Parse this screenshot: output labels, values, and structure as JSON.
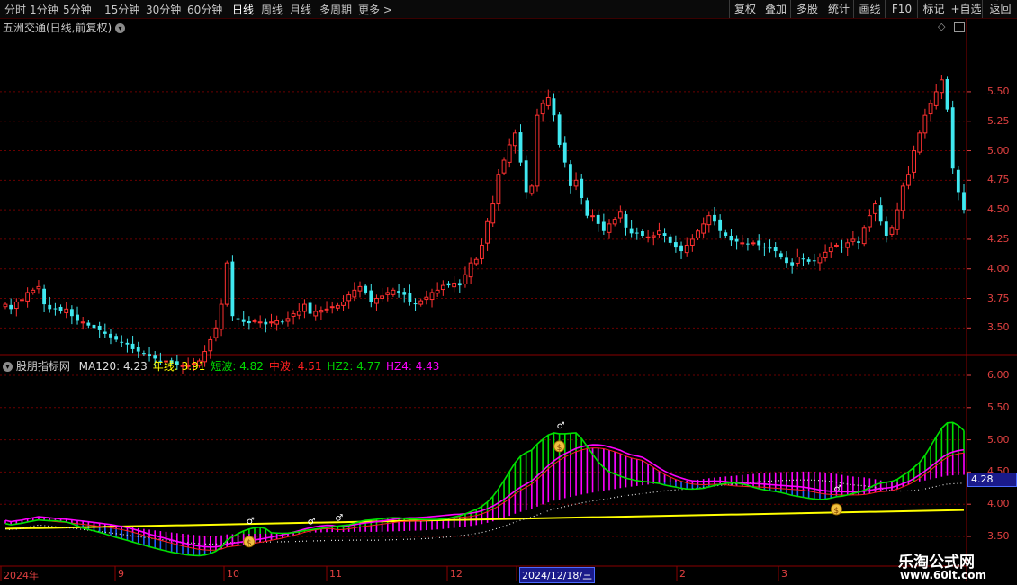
{
  "toolbar": {
    "periods": [
      "分时",
      "1分钟",
      "5分钟",
      "15分钟",
      "30分钟",
      "60分钟",
      "日线",
      "周线",
      "月线",
      "多周期",
      "更多"
    ],
    "active_period": "日线",
    "more_arrow": ">",
    "right_buttons": [
      "复权",
      "叠加",
      "多股",
      "统计",
      "画线",
      "F10",
      "标记",
      "+自选",
      "返回"
    ]
  },
  "main_chart": {
    "title": "五洲交通(日线,前复权)",
    "y_ticks": [
      "5.50",
      "5.25",
      "5.00",
      "4.75",
      "4.50",
      "4.25",
      "4.00",
      "3.75",
      "3.50"
    ]
  },
  "indicator": {
    "name": "股朋指标网",
    "fields": [
      {
        "label": "MA120:",
        "value": "4.23",
        "color": "#e0e0e0"
      },
      {
        "label": "年线:",
        "value": "3.91",
        "color": "#ffff00"
      },
      {
        "label": "短波:",
        "value": "4.82",
        "color": "#00e000"
      },
      {
        "label": "中波:",
        "value": "4.51",
        "color": "#ff2020"
      },
      {
        "label": "HZ2:",
        "value": "4.77",
        "color": "#00d000"
      },
      {
        "label": "HZ4:",
        "value": "4.43",
        "color": "#ff00ff"
      }
    ],
    "y_ticks": [
      "6.00",
      "5.50",
      "5.00",
      "4.50",
      "4.00",
      "3.50"
    ],
    "current_value": "4.28",
    "marker_symbol": "♂",
    "moneybag_symbol": "$"
  },
  "date_axis": [
    "2024年",
    "9",
    "10",
    "11",
    "12",
    "2024/12/18/三",
    "2",
    "3"
  ],
  "watermark": {
    "line1": "乐淘公式网",
    "line2": "www.60lt.com"
  },
  "colors": {
    "up": "#ff3030",
    "down": "#40e8f0",
    "grid": "#6a0000",
    "axis": "#e04040"
  },
  "chart_data": {
    "type": "candlestick",
    "title": "五洲交通(日线,前复权)",
    "ylim": [
      3.35,
      5.85
    ],
    "y_ticks": [
      3.5,
      3.75,
      4.0,
      4.25,
      4.5,
      4.75,
      5.0,
      5.25,
      5.5
    ],
    "close": [
      3.7,
      3.66,
      3.72,
      3.74,
      3.8,
      3.82,
      3.85,
      3.7,
      3.66,
      3.66,
      3.64,
      3.66,
      3.6,
      3.56,
      3.55,
      3.52,
      3.5,
      3.48,
      3.45,
      3.42,
      3.4,
      3.38,
      3.36,
      3.32,
      3.3,
      3.28,
      3.26,
      3.24,
      3.22,
      3.22,
      3.2,
      3.19,
      3.18,
      3.18,
      3.2,
      3.22,
      3.3,
      3.4,
      3.5,
      3.7,
      4.05,
      3.6,
      3.58,
      3.55,
      3.54,
      3.56,
      3.55,
      3.53,
      3.55,
      3.56,
      3.55,
      3.58,
      3.62,
      3.64,
      3.7,
      3.62,
      3.64,
      3.65,
      3.66,
      3.68,
      3.69,
      3.72,
      3.78,
      3.82,
      3.85,
      3.8,
      3.72,
      3.75,
      3.77,
      3.8,
      3.82,
      3.8,
      3.78,
      3.72,
      3.7,
      3.73,
      3.76,
      3.8,
      3.82,
      3.86,
      3.86,
      3.88,
      3.86,
      3.95,
      4.05,
      4.08,
      4.2,
      4.4,
      4.55,
      4.8,
      4.92,
      5.05,
      5.15,
      4.9,
      4.65,
      4.7,
      5.3,
      5.4,
      5.45,
      5.3,
      5.05,
      4.9,
      4.7,
      4.75,
      4.6,
      4.45,
      4.45,
      4.38,
      4.32,
      4.38,
      4.42,
      4.48,
      4.35,
      4.3,
      4.3,
      4.28,
      4.27,
      4.28,
      4.32,
      4.28,
      4.22,
      4.18,
      4.15,
      4.2,
      4.25,
      4.32,
      4.38,
      4.45,
      4.4,
      4.32,
      4.28,
      4.24,
      4.23,
      4.22,
      4.21,
      4.22,
      4.2,
      4.18,
      4.17,
      4.15,
      4.1,
      4.05,
      4.03,
      4.1,
      4.08,
      4.06,
      4.07,
      4.1,
      4.14,
      4.18,
      4.2,
      4.18,
      4.22,
      4.25,
      4.22,
      4.35,
      4.45,
      4.55,
      4.4,
      4.28,
      4.35,
      4.5,
      4.7,
      4.8,
      5.0,
      5.15,
      5.3,
      5.4,
      5.5,
      5.6,
      5.35,
      4.85,
      4.65,
      4.5
    ]
  }
}
